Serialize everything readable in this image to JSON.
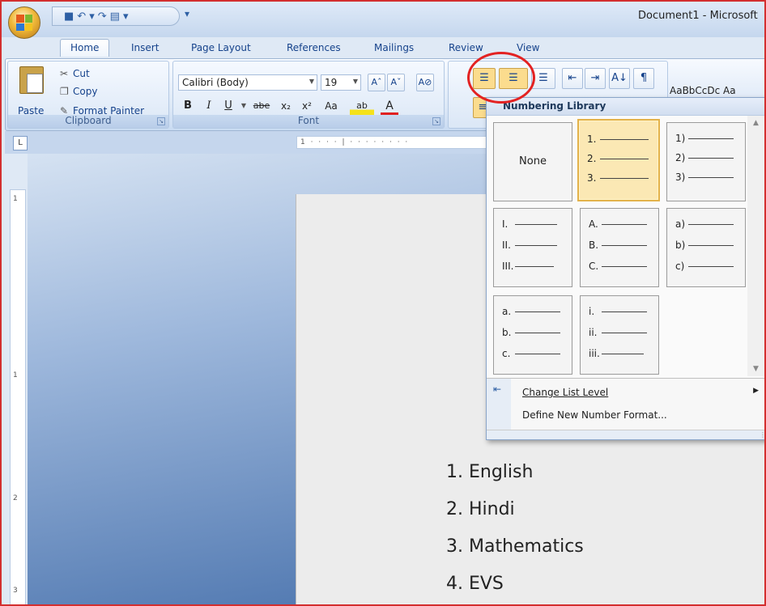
{
  "window": {
    "title": "Document1 - Microsoft",
    "qat": [
      "■",
      "↶",
      "▾",
      "↷",
      "▤",
      "▾"
    ],
    "qat_customize": "▾"
  },
  "tabs": [
    {
      "label": "Home",
      "active": true
    },
    {
      "label": "Insert"
    },
    {
      "label": "Page Layout"
    },
    {
      "label": "References"
    },
    {
      "label": "Mailings"
    },
    {
      "label": "Review"
    },
    {
      "label": "View"
    }
  ],
  "clipboard": {
    "label": "Clipboard",
    "paste": "Paste",
    "cut": "Cut",
    "copy": "Copy",
    "format_painter": "Format Painter"
  },
  "font": {
    "label": "Font",
    "family": "Calibri (Body)",
    "size": "19",
    "grow": "Aˆ",
    "shrink": "Aˇ",
    "clear": "A⊘",
    "bold": "B",
    "italic": "I",
    "underline": "U",
    "strike": "abe",
    "subscript": "x₂",
    "superscript": "x²",
    "change_case": "Aa",
    "highlight": "ab",
    "font_color": "A"
  },
  "paragraph": {
    "bullets": "☰",
    "numbering": "☰",
    "multilevel": "☰",
    "decrease_indent": "⇤",
    "increase_indent": "⇥",
    "sort": "A↓",
    "show_marks": "¶",
    "align_left": "≡",
    "align_center": "≡"
  },
  "styles": {
    "preview": "AaBbCcDc  Aa"
  },
  "ruler": {
    "tab_selector": "L",
    "horizontal_marks": "1 · · · · | · · · · · · · ·",
    "vertical_marks": [
      "1",
      "1",
      "2",
      "3"
    ]
  },
  "numbering_library": {
    "header": "Numbering Library",
    "none_label": "None",
    "formats": [
      {
        "id": "numeric-dot",
        "markers": [
          "1.",
          "2.",
          "3."
        ],
        "selected": true
      },
      {
        "id": "numeric-paren",
        "markers": [
          "1)",
          "2)",
          "3)"
        ]
      },
      {
        "id": "roman-upper",
        "markers": [
          "I.",
          "II.",
          "III."
        ]
      },
      {
        "id": "alpha-upper",
        "markers": [
          "A.",
          "B.",
          "C."
        ]
      },
      {
        "id": "alpha-lower-paren",
        "markers": [
          "a)",
          "b)",
          "c)"
        ]
      },
      {
        "id": "alpha-lower-dot",
        "markers": [
          "a.",
          "b.",
          "c."
        ]
      },
      {
        "id": "roman-lower",
        "markers": [
          "i.",
          "ii.",
          "iii."
        ]
      }
    ],
    "change_list_level": "Change List Level",
    "define_new_format": "Define New Number Format..."
  },
  "document": {
    "items": [
      "1. English",
      "2. Hindi",
      "3. Mathematics",
      "4. EVS"
    ]
  },
  "colors": {
    "accent_circle": "#e32222",
    "selected_cell": "#fbe8b4"
  }
}
